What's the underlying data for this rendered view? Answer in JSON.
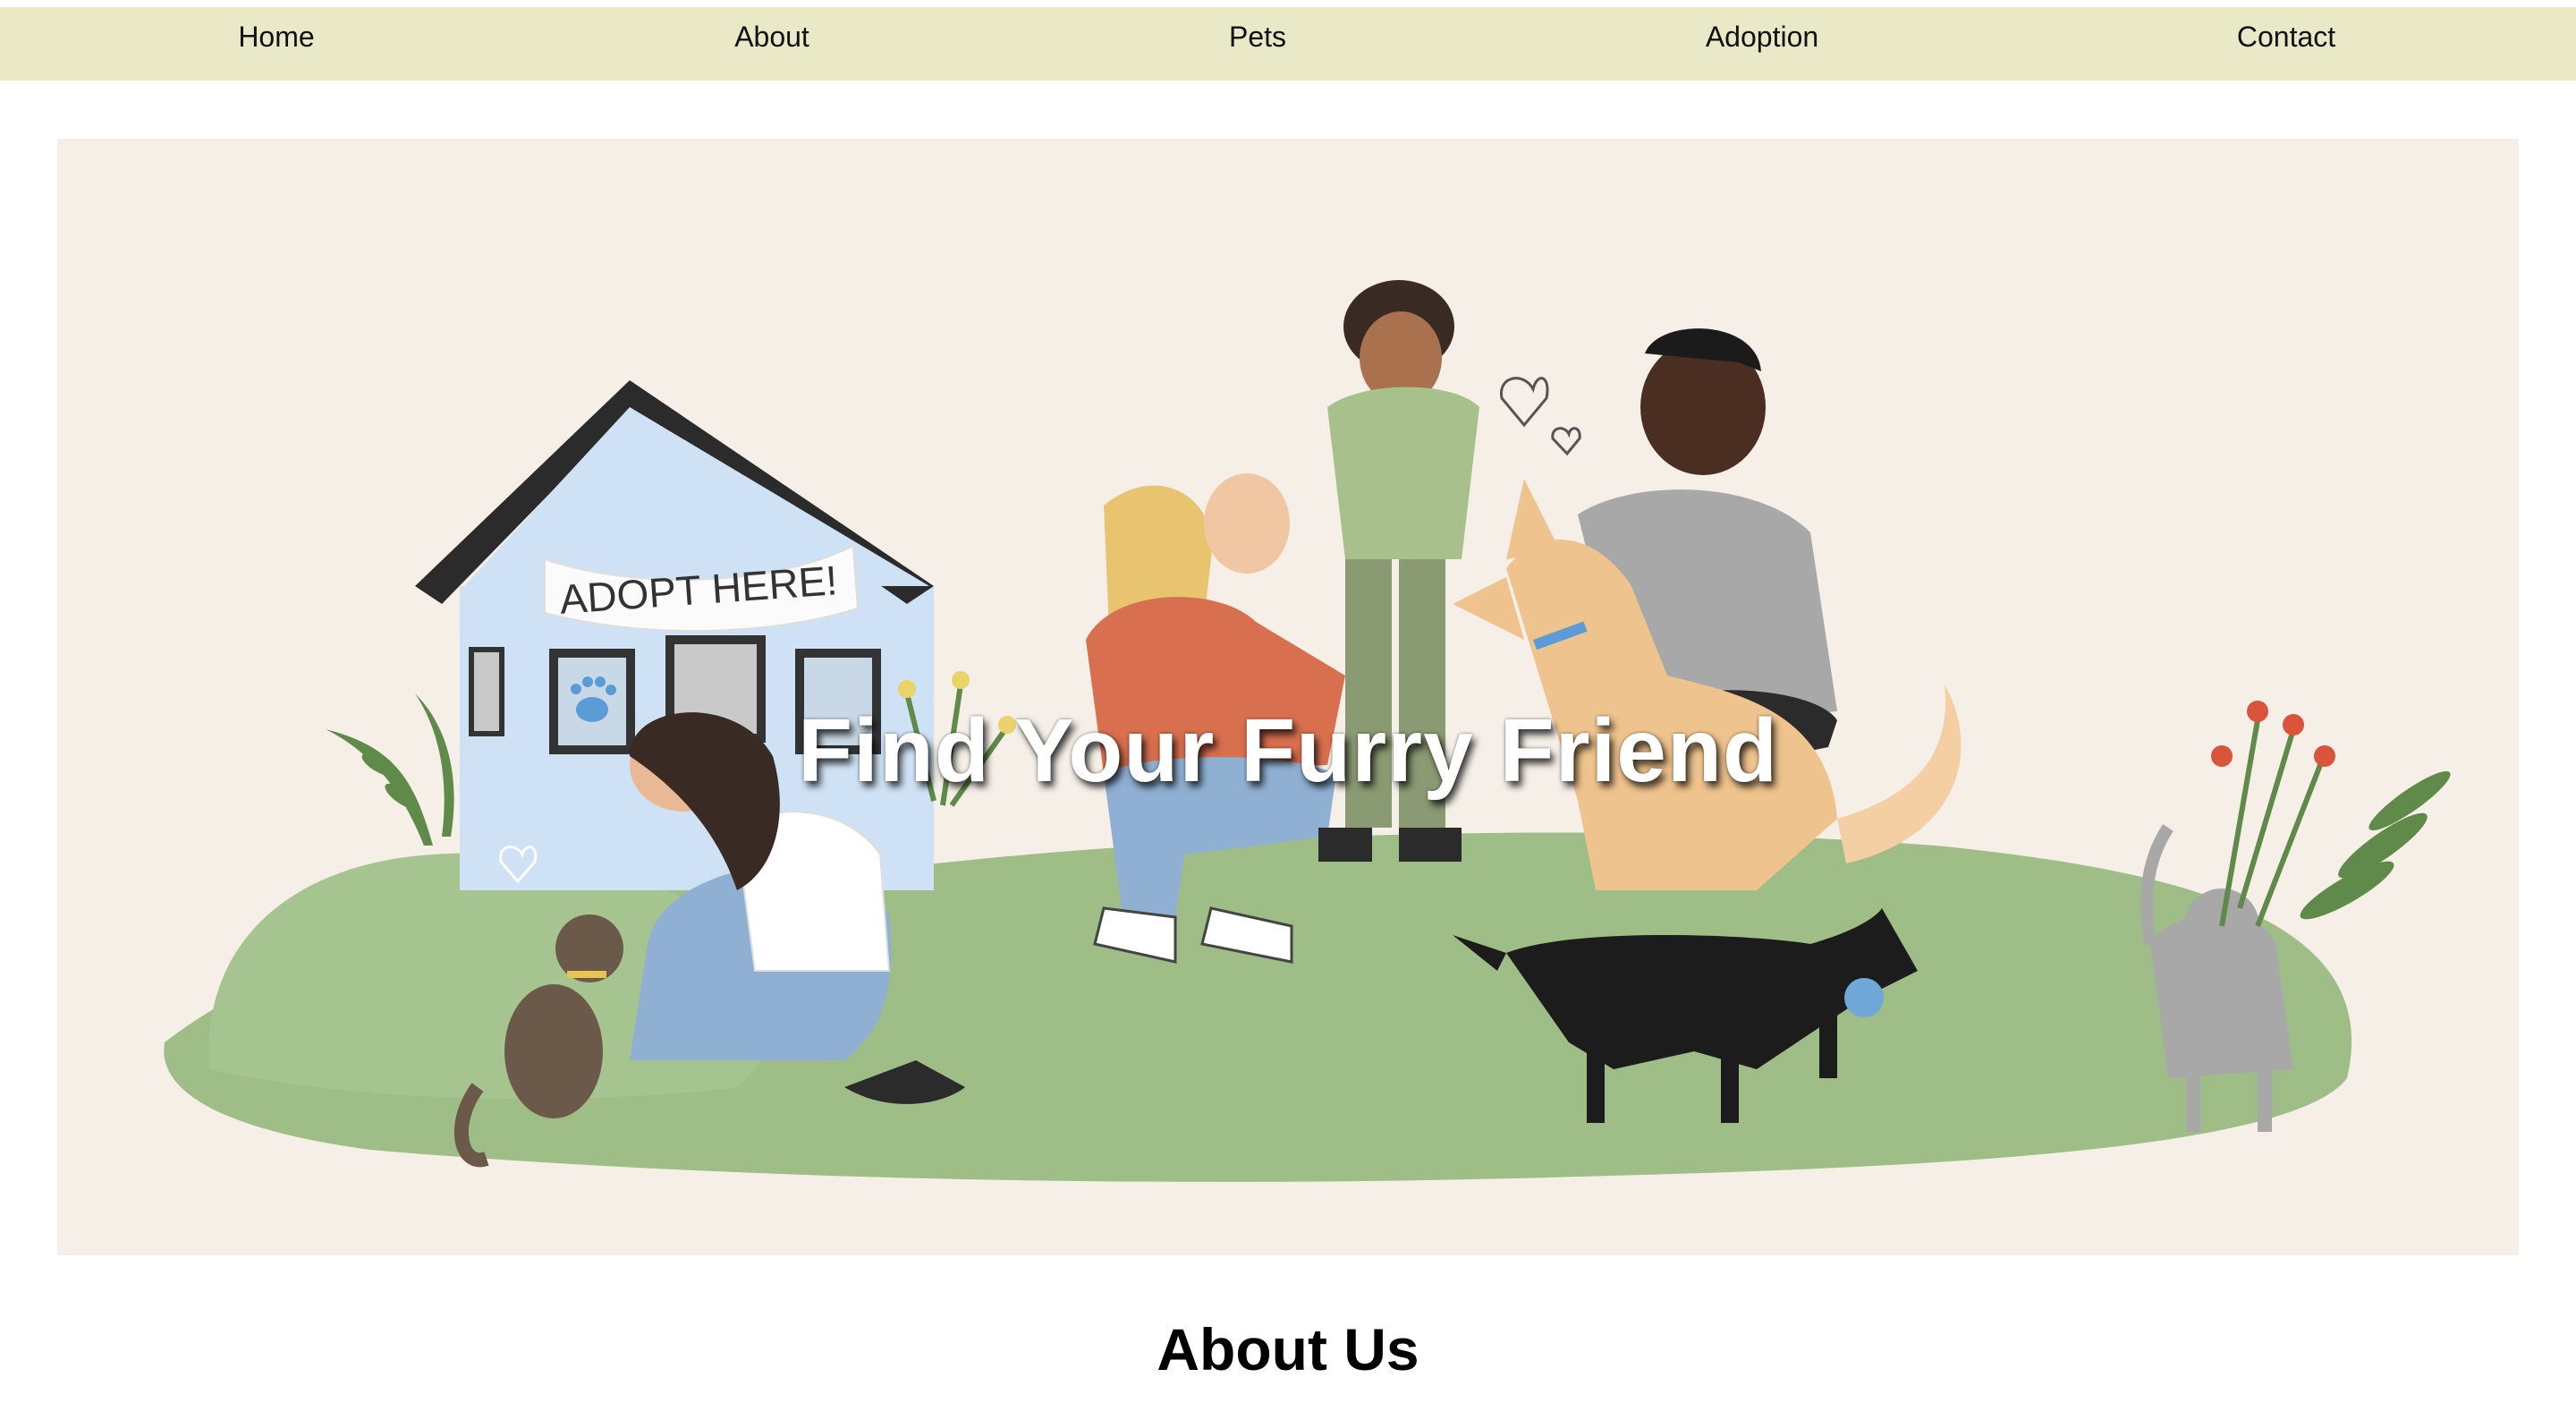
{
  "nav": {
    "items": [
      {
        "label": "Home"
      },
      {
        "label": "About"
      },
      {
        "label": "Pets"
      },
      {
        "label": "Adoption"
      },
      {
        "label": "Contact"
      }
    ],
    "background": "#eae9c7"
  },
  "hero": {
    "title": "Find Your Furry Friend",
    "banner_text": "ADOPT HERE!",
    "background": "#f5efe8"
  },
  "about": {
    "heading": "About Us"
  }
}
